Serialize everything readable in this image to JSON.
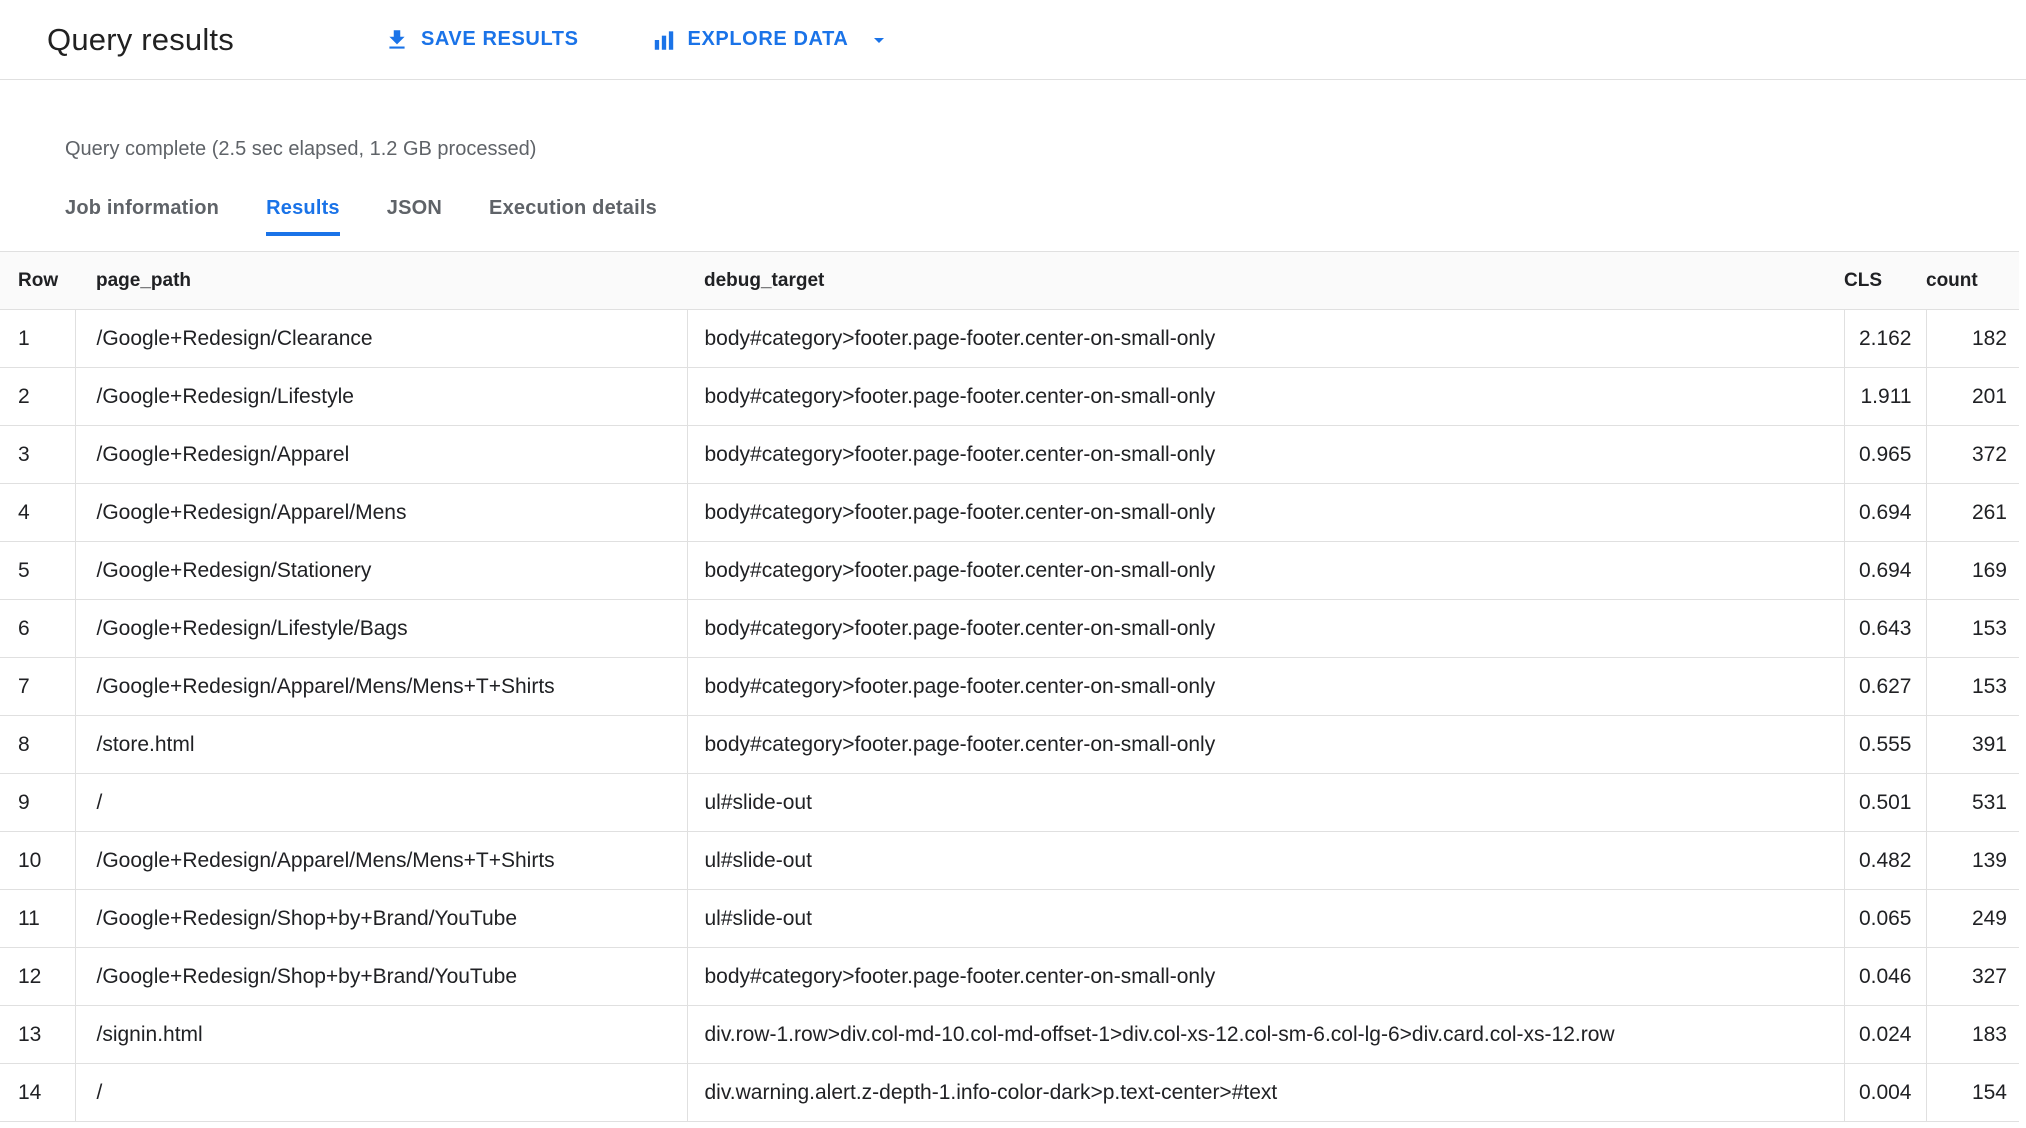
{
  "header": {
    "title": "Query results",
    "save_results_label": "SAVE RESULTS",
    "explore_data_label": "EXPLORE DATA"
  },
  "status_text": "Query complete (2.5 sec elapsed, 1.2 GB processed)",
  "tabs": [
    {
      "label": "Job information",
      "active": false
    },
    {
      "label": "Results",
      "active": true
    },
    {
      "label": "JSON",
      "active": false
    },
    {
      "label": "Execution details",
      "active": false
    }
  ],
  "table": {
    "columns": [
      "Row",
      "page_path",
      "debug_target",
      "CLS",
      "count"
    ],
    "rows": [
      {
        "row": "1",
        "page_path": "/Google+Redesign/Clearance",
        "debug_target": "body#category>footer.page-footer.center-on-small-only",
        "cls": "2.162",
        "count": "182"
      },
      {
        "row": "2",
        "page_path": "/Google+Redesign/Lifestyle",
        "debug_target": "body#category>footer.page-footer.center-on-small-only",
        "cls": "1.911",
        "count": "201"
      },
      {
        "row": "3",
        "page_path": "/Google+Redesign/Apparel",
        "debug_target": "body#category>footer.page-footer.center-on-small-only",
        "cls": "0.965",
        "count": "372"
      },
      {
        "row": "4",
        "page_path": "/Google+Redesign/Apparel/Mens",
        "debug_target": "body#category>footer.page-footer.center-on-small-only",
        "cls": "0.694",
        "count": "261"
      },
      {
        "row": "5",
        "page_path": "/Google+Redesign/Stationery",
        "debug_target": "body#category>footer.page-footer.center-on-small-only",
        "cls": "0.694",
        "count": "169"
      },
      {
        "row": "6",
        "page_path": "/Google+Redesign/Lifestyle/Bags",
        "debug_target": "body#category>footer.page-footer.center-on-small-only",
        "cls": "0.643",
        "count": "153"
      },
      {
        "row": "7",
        "page_path": "/Google+Redesign/Apparel/Mens/Mens+T+Shirts",
        "debug_target": "body#category>footer.page-footer.center-on-small-only",
        "cls": "0.627",
        "count": "153"
      },
      {
        "row": "8",
        "page_path": "/store.html",
        "debug_target": "body#category>footer.page-footer.center-on-small-only",
        "cls": "0.555",
        "count": "391"
      },
      {
        "row": "9",
        "page_path": "/",
        "debug_target": "ul#slide-out",
        "cls": "0.501",
        "count": "531"
      },
      {
        "row": "10",
        "page_path": "/Google+Redesign/Apparel/Mens/Mens+T+Shirts",
        "debug_target": "ul#slide-out",
        "cls": "0.482",
        "count": "139"
      },
      {
        "row": "11",
        "page_path": "/Google+Redesign/Shop+by+Brand/YouTube",
        "debug_target": "ul#slide-out",
        "cls": "0.065",
        "count": "249"
      },
      {
        "row": "12",
        "page_path": "/Google+Redesign/Shop+by+Brand/YouTube",
        "debug_target": "body#category>footer.page-footer.center-on-small-only",
        "cls": "0.046",
        "count": "327"
      },
      {
        "row": "13",
        "page_path": "/signin.html",
        "debug_target": "div.row-1.row>div.col-md-10.col-md-offset-1>div.col-xs-12.col-sm-6.col-lg-6>div.card.col-xs-12.row",
        "cls": "0.024",
        "count": "183"
      },
      {
        "row": "14",
        "page_path": "/",
        "debug_target": "div.warning.alert.z-depth-1.info-color-dark>p.text-center>#text",
        "cls": "0.004",
        "count": "154"
      }
    ]
  },
  "icons": {
    "save": "download-icon",
    "explore": "bar-chart-icon",
    "dropdown": "arrow-drop-down-icon"
  },
  "colors": {
    "accent_blue": "#1a73e8",
    "border_gray": "#e0e0e0",
    "text_dark": "#202124",
    "text_muted": "#5f6368",
    "table_header_bg": "#fafafa"
  }
}
